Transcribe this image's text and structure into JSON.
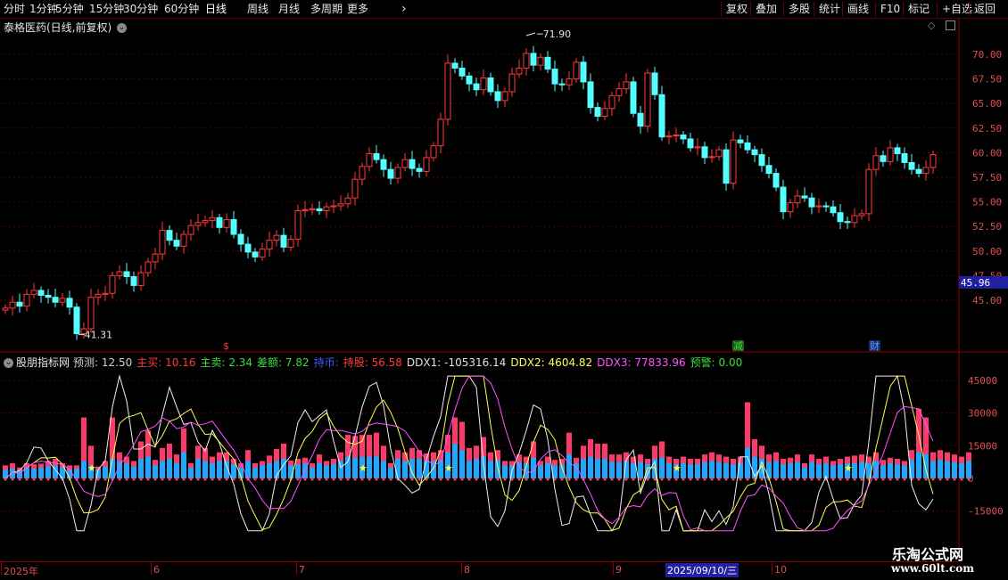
{
  "toolbar": {
    "periods": [
      "分时",
      "1分钟",
      "5分钟",
      "15分钟",
      "30分钟",
      "60分钟",
      "日线",
      "周线",
      "月线",
      "多周期",
      "更多"
    ],
    "active_period": "日线",
    "more_icon": "chevron-right-icon",
    "actions": [
      "复权",
      "叠加",
      "多股",
      "统计",
      "画线",
      "F10",
      "标记",
      "+自选",
      "返回"
    ]
  },
  "main_chart": {
    "title": "泰格医药(日线,前复权)",
    "y_labels": [
      "70.00",
      "67.50",
      "65.00",
      "62.50",
      "60.00",
      "57.50",
      "55.00",
      "52.50",
      "50.00",
      "47.50",
      "45.00"
    ],
    "current_price": "45.96",
    "high_label": "71.90",
    "low_label": "41.31",
    "event_markers": [
      "$",
      "减",
      "财"
    ],
    "colors": {
      "up": "#ff3b3b",
      "down": "#54ffff",
      "grid": "#5a0000"
    }
  },
  "indicator": {
    "name": "股朋指标网",
    "fields": [
      {
        "label": "预测:",
        "value": "12.50",
        "color": "#d0d0d0"
      },
      {
        "label": "主买:",
        "value": "10.16",
        "color": "#ff3b3b"
      },
      {
        "label": "主卖:",
        "value": "2.34",
        "color": "#3cdc3c"
      },
      {
        "label": "差额:",
        "value": "7.82",
        "color": "#3cdc3c"
      },
      {
        "label": "持币:",
        "value": "",
        "color": "#3c5cff"
      },
      {
        "label": "持股:",
        "value": "56.58",
        "color": "#ff3b3b"
      },
      {
        "label": "DDX1:",
        "value": "-105316.14",
        "color": "#e0e0e0"
      },
      {
        "label": "DDX2:",
        "value": "4604.82",
        "color": "#ffff54"
      },
      {
        "label": "DDX3:",
        "value": "77833.96",
        "color": "#ff54ff"
      },
      {
        "label": "预警:",
        "value": "0.00",
        "color": "#3cdc3c"
      }
    ],
    "y_labels": [
      "45000",
      "30000",
      "15000",
      "0",
      "-15000"
    ]
  },
  "date_axis": {
    "labels": [
      "2025年",
      "6",
      "7",
      "8",
      "9",
      "10"
    ],
    "cursor_date": "2025/09/10/三"
  },
  "watermark": {
    "line1": "乐淘公式网",
    "line2": "www.60lt.com"
  },
  "chart_data": [
    {
      "type": "candlestick",
      "title": "泰格医药(日线,前复权)",
      "ylim": [
        41.31,
        71.9
      ],
      "y_ticks": [
        45.0,
        47.5,
        50.0,
        52.5,
        55.0,
        57.5,
        60.0,
        62.5,
        65.0,
        67.5,
        70.0
      ],
      "x_labels": [
        "2025年",
        "6",
        "7",
        "8",
        "9",
        "10"
      ],
      "close": [
        44.2,
        44.8,
        44.4,
        45.6,
        46.0,
        45.5,
        45.3,
        44.8,
        45.2,
        44.3,
        41.6,
        42.1,
        45.3,
        45.6,
        45.7,
        47.5,
        47.9,
        47.4,
        46.5,
        47.8,
        48.9,
        49.7,
        52.1,
        51.1,
        50.5,
        51.7,
        52.6,
        52.9,
        53.1,
        53.4,
        52.4,
        53.2,
        51.7,
        50.7,
        49.9,
        49.4,
        50.2,
        51.1,
        51.6,
        50.4,
        51.2,
        54.1,
        54.2,
        54.3,
        54.1,
        54.5,
        54.6,
        54.8,
        55.4,
        57.3,
        58.6,
        59.9,
        59.3,
        58.3,
        57.4,
        58.5,
        59.3,
        58.4,
        58.1,
        59.5,
        60.7,
        63.4,
        69.1,
        68.6,
        67.8,
        67.0,
        66.4,
        67.6,
        66.2,
        65.3,
        66.2,
        68.0,
        68.6,
        70.1,
        68.9,
        69.7,
        68.5,
        67.0,
        66.9,
        67.5,
        69.2,
        67.2,
        64.6,
        63.7,
        64.5,
        65.8,
        66.5,
        67.2,
        64.0,
        62.7,
        68.1,
        65.9,
        61.6,
        61.7,
        61.8,
        61.4,
        60.5,
        60.6,
        59.5,
        59.6,
        60.3,
        56.9,
        61.3,
        61.0,
        60.3,
        59.8,
        58.7,
        57.9,
        56.5,
        54.0,
        54.9,
        55.6,
        55.4,
        54.5,
        54.6,
        54.5,
        53.9,
        53.0,
        52.9,
        53.6,
        53.8,
        58.3,
        59.7,
        59.1,
        60.5,
        59.9,
        59.0,
        58.3,
        57.9,
        58.5,
        59.8
      ]
    },
    {
      "type": "bar",
      "title": "股朋指标网",
      "ylim": [
        -25000,
        50000
      ],
      "y_ticks": [
        -15000,
        0,
        15000,
        30000,
        45000
      ],
      "series": [
        {
          "name": "主买",
          "values": [
            6000,
            7000,
            5000,
            7000,
            6500,
            6800,
            8000,
            9000,
            7000,
            6000,
            6000,
            28000,
            15000,
            5500,
            8000,
            28000,
            12000,
            10000,
            8000,
            17000,
            22000,
            8500,
            14000,
            16000,
            11000,
            23000,
            7000,
            15000,
            14000,
            10000,
            12000,
            12000,
            9000,
            7000,
            13000,
            7000,
            8000,
            10500,
            13500,
            16000,
            8200,
            9000,
            9500,
            7000,
            11000,
            8000,
            9000,
            12000,
            20000,
            19500,
            20000,
            20000,
            21000,
            15000,
            7000,
            13000,
            12000,
            14000,
            13000,
            11500,
            12000,
            13000,
            20000,
            28000,
            26000,
            14000,
            15000,
            19000,
            12000,
            13000,
            8000,
            8000,
            11000,
            10000,
            17000,
            8000,
            10000,
            8500,
            9000,
            21000,
            9500,
            15000,
            18000,
            16000,
            16000,
            11000,
            11000,
            12000,
            10000,
            11000,
            9000,
            15000,
            17000,
            10000,
            9000,
            10000,
            9000,
            9000,
            11000,
            12000,
            11000,
            10000,
            9000,
            10000,
            35000,
            18000,
            15000,
            11000,
            12000,
            9000,
            9500,
            11000,
            7000,
            11000,
            9000,
            10000,
            8000,
            9000,
            10000,
            10500,
            11000,
            10000,
            12000,
            8500,
            9500,
            9000,
            8000,
            13000,
            32000,
            28000,
            12000,
            13000,
            12000,
            11000,
            10000,
            12000
          ]
        },
        {
          "name": "主卖",
          "values": [
            4000,
            4500,
            3500,
            5000,
            4500,
            5000,
            5500,
            6000,
            5000,
            4000,
            4500,
            8000,
            6000,
            4000,
            5500,
            9000,
            8000,
            7000,
            5500,
            9000,
            10000,
            6000,
            8000,
            9000,
            7000,
            12000,
            5000,
            9000,
            8000,
            7000,
            8000,
            8000,
            6500,
            5000,
            8000,
            5000,
            6000,
            7000,
            8000,
            9000,
            6000,
            6500,
            7000,
            5000,
            7000,
            6000,
            6500,
            8000,
            10000,
            9500,
            10000,
            10000,
            10000,
            8000,
            5000,
            9000,
            8000,
            9000,
            9000,
            8000,
            8000,
            8500,
            12000,
            16000,
            13000,
            8000,
            9000,
            10000,
            8000,
            8500,
            6000,
            6000,
            7500,
            7000,
            9500,
            6000,
            7000,
            6000,
            6500,
            11000,
            7000,
            9000,
            10000,
            9000,
            9000,
            7500,
            7500,
            8000,
            7000,
            7500,
            6500,
            9000,
            9500,
            7000,
            6500,
            7000,
            6500,
            6500,
            7500,
            8000,
            7500,
            7000,
            6500,
            7000,
            14000,
            10000,
            9000,
            7500,
            8000,
            6500,
            7000,
            7500,
            5000,
            7500,
            6500,
            7000,
            6000,
            6500,
            7000,
            7000,
            7500,
            7000,
            8000,
            6000,
            7000,
            6500,
            6000,
            8500,
            12000,
            11000,
            8000,
            8500,
            8000,
            7500,
            7000,
            8000
          ]
        }
      ]
    }
  ]
}
